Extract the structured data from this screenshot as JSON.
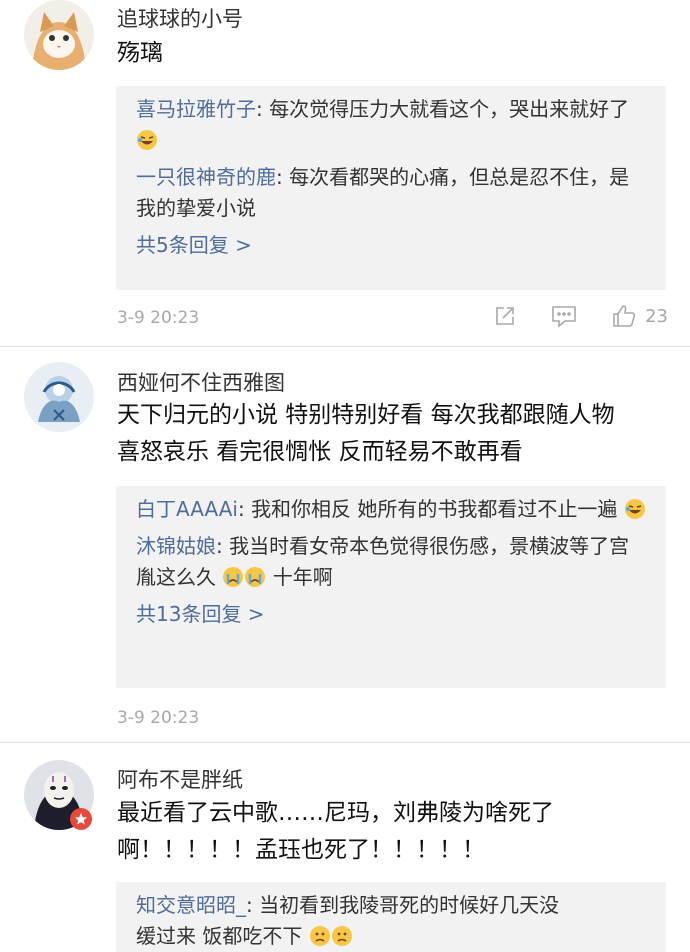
{
  "comments": [
    {
      "username": "追球球的小号",
      "text": "殇璃",
      "replies": [
        {
          "name": "喜马拉雅竹子",
          "sep": ": ",
          "text": "每次觉得压力大就看这个，哭出来就好了"
        },
        {
          "name": "一只很神奇的鹿",
          "sep": ": ",
          "text": "每次看都哭的心痛，但总是忍不住，是我的挚爱小说"
        }
      ],
      "more": "共5条回复 >",
      "timestamp": "3-9 20:23",
      "likes": "23"
    },
    {
      "username": "西娅何不住西雅图",
      "text_line1": "天下归元的小说 特别特别好看 每次我都跟随人物",
      "text_line2": "喜怒哀乐 看完很惆怅 反而轻易不敢再看",
      "replies": [
        {
          "name": "白丁AAAAi",
          "sep": ": ",
          "text": "我和你相反  她所有的书我都看过不止一遍"
        },
        {
          "name": "沐锦姑娘",
          "sep": ": ",
          "text": "我当时看女帝本色觉得很伤感，景横波等了宫胤这么久",
          "tail": "十年啊"
        }
      ],
      "more": "共13条回复 >",
      "timestamp": "3-9 20:23"
    },
    {
      "username": "阿布不是胖纸",
      "text_line1": "最近看了云中歌……尼玛，刘弗陵为啥死了",
      "text_line2": "啊！！！！！孟珏也死了！！！！！",
      "replies": [
        {
          "name": "知交意昭昭_",
          "sep": ": ",
          "text_line1": "当初看到我陵哥死的时候好几天没",
          "text_line2": "缓过来 饭都吃不下"
        }
      ]
    }
  ],
  "icons": {
    "share": "share-icon",
    "comment": "comment-icon",
    "like": "thumbs-up-icon"
  },
  "colors": {
    "link": "#4f6d9a",
    "meta": "#a8a8a8",
    "reply_bg": "#f2f2f2"
  }
}
